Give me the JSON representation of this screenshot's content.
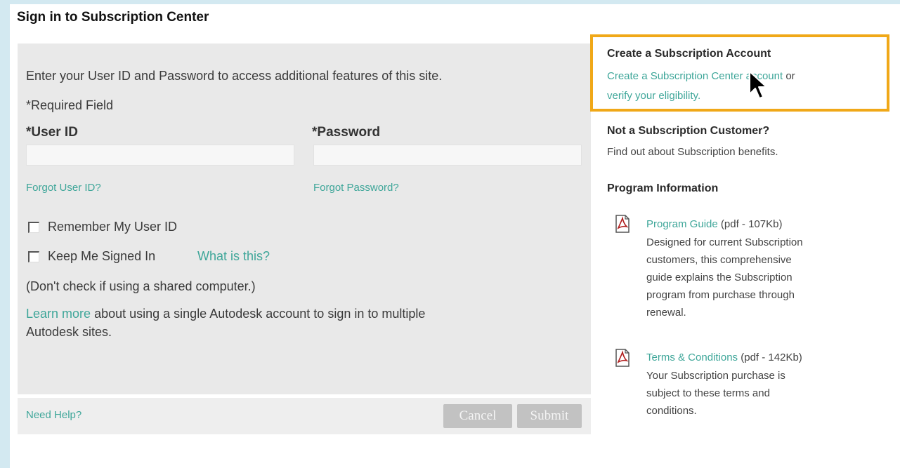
{
  "page": {
    "title": "Sign in to Subscription Center"
  },
  "signin": {
    "intro": "Enter your User ID and Password to access additional features of this site.",
    "required_note": "*Required Field",
    "userid_label": "*User ID",
    "password_label": "*Password",
    "userid_value": "",
    "password_value": "",
    "forgot_userid": "Forgot User ID?",
    "forgot_password": "Forgot Password?",
    "remember_label": "Remember My User ID",
    "keep_signed_label": "Keep Me Signed In",
    "what_is_this": "What is this?",
    "shared_note": "(Don't check if using a shared computer.)",
    "learn_more_link": "Learn more",
    "learn_more_text": "about using a single Autodesk account to sign in to multiple",
    "learn_more_text2": "Autodesk sites.",
    "need_help": "Need Help?",
    "cancel_button": "Cancel",
    "submit_button": "Submit"
  },
  "sidebar": {
    "create_heading": "Create a Subscription Account",
    "create_link": "Create a Subscription Center account",
    "create_or": "or",
    "verify_link": "verify your eligibility",
    "verify_period": ".",
    "not_customer_heading": "Not a Subscription Customer?",
    "find_out_link": "Find out about Subscription benefits.",
    "program_info_heading": "Program Information",
    "guide": {
      "link": "Program Guide",
      "size": "(pdf - 107Kb)",
      "desc": [
        "Designed for current Subscription",
        "customers, this comprehensive",
        "guide explains the Subscription",
        "program from purchase through",
        "renewal."
      ]
    },
    "terms": {
      "link": "Terms & Conditions",
      "size": "(pdf - 142Kb)",
      "desc": [
        "Your Subscription purchase is",
        "subject to these terms and",
        "conditions."
      ]
    }
  },
  "colors": {
    "link": "#3ea699",
    "highlight": "#f0a818",
    "panel": "#e9e9e9",
    "background": "#d3e9f1"
  },
  "icons": [
    "pdf-icon",
    "mouse-cursor-icon"
  ]
}
